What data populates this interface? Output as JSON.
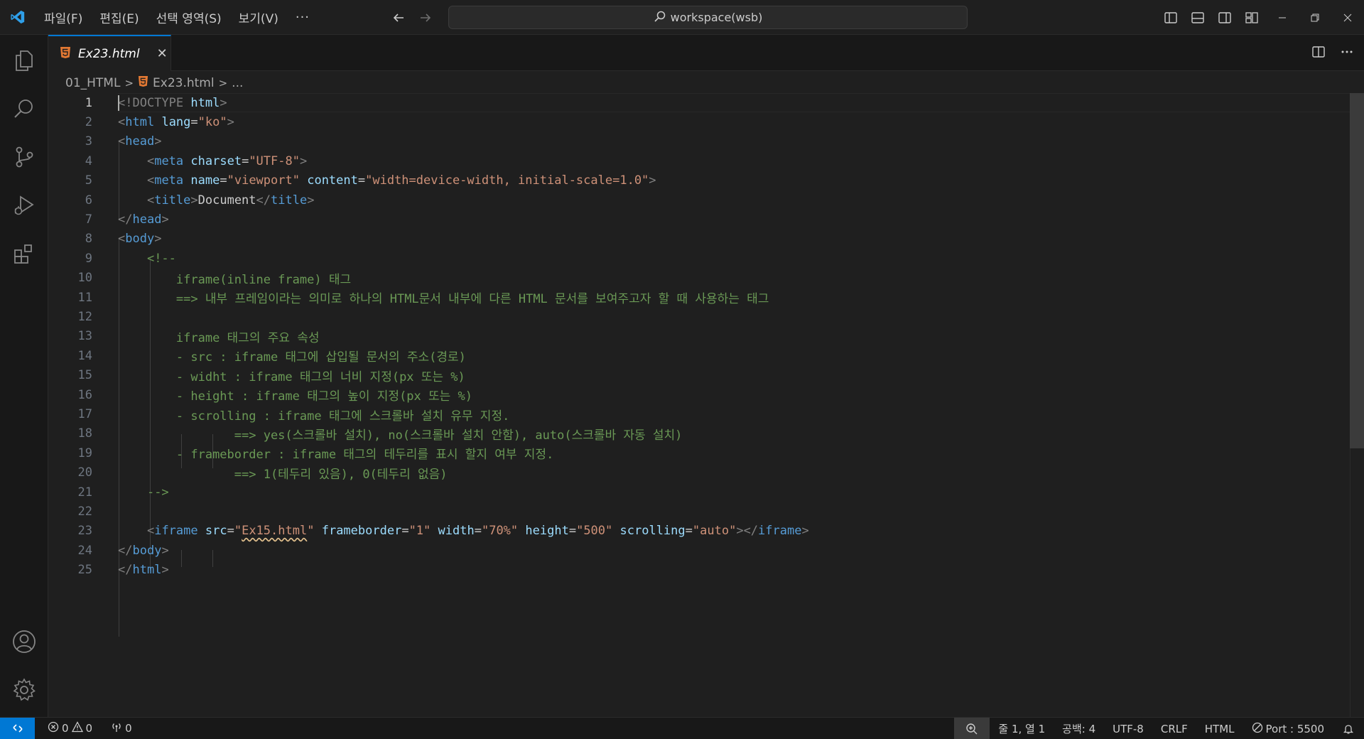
{
  "titlebar": {
    "menu": [
      "파일(F)",
      "편집(E)",
      "선택 영역(S)",
      "보기(V)"
    ],
    "menu_more": "···",
    "search_text": "workspace(wsb)"
  },
  "tab": {
    "label": "Ex23.html",
    "close": "✕"
  },
  "breadcrumb": {
    "folder": "01_HTML",
    "file": "Ex23.html",
    "more": "..."
  },
  "editor": {
    "line_numbers": [
      "1",
      "2",
      "3",
      "4",
      "5",
      "6",
      "7",
      "8",
      "9",
      "10",
      "11",
      "12",
      "13",
      "14",
      "15",
      "16",
      "17",
      "18",
      "19",
      "20",
      "21",
      "22",
      "23",
      "24",
      "25"
    ],
    "comment_lines": {
      "l9": "<!--",
      "l10": "iframe(inline frame) 태그",
      "l11": "==> 내부 프레임이라는 의미로 하나의 HTML문서 내부에 다른 HTML 문서를 보여주고자 할 때 사용하는 태그",
      "l13": "iframe 태그의 주요 속성",
      "l14": "- src : iframe 태그에 삽입될 문서의 주소(경로)",
      "l15": "- widht : iframe 태그의 너비 지정(px 또는 %)",
      "l16": "- height : iframe 태그의 높이 지정(px 또는 %)",
      "l17": "- scrolling : iframe 태그에 스크롤바 설치 유무 지정.",
      "l18": "==> yes(스크롤바 설치), no(스크롤바 설치 안함), auto(스크롤바 자동 설치)",
      "l19": "- frameborder : iframe 태그의 테두리를 표시 할지 여부 지정.",
      "l20": "==> 1(테두리 있음), 0(테두리 없음)",
      "l21": "-->"
    },
    "tokens": {
      "doctype_open": "<!DOCTYPE",
      "doctype_kw": "html",
      "lt": "<",
      "gt": ">",
      "lt_slash": "</",
      "eq": "=",
      "html": "html",
      "lang": "lang",
      "lang_val": "\"ko\"",
      "head": "head",
      "meta": "meta",
      "charset": "charset",
      "charset_val": "\"UTF-8\"",
      "name": "name",
      "name_val": "\"viewport\"",
      "content": "content",
      "content_val": "\"width=device-width, initial-scale=1.0\"",
      "title": "title",
      "title_text": "Document",
      "body": "body",
      "iframe": "iframe",
      "src": "src",
      "src_q1": "\"",
      "src_val": "Ex15.html",
      "src_q2": "\"",
      "frameborder": "frameborder",
      "frameborder_val": "\"1\"",
      "width": "width",
      "width_val": "\"70%\"",
      "height": "height",
      "height_val": "\"500\"",
      "scrolling": "scrolling",
      "scrolling_val": "\"auto\""
    }
  },
  "statusbar": {
    "errors": "0",
    "warnings": "0",
    "ports": "0",
    "cursor_pos": "줄 1, 열 1",
    "spaces": "공백: 4",
    "encoding": "UTF-8",
    "eol": "CRLF",
    "language": "HTML",
    "port": "Port : 5500"
  },
  "colors": {
    "accent": "#0078d4",
    "tag": "#569cd6",
    "attribute": "#9cdcfe",
    "string": "#ce9178",
    "comment": "#6a9955",
    "html_file_icon": "#e37933"
  }
}
